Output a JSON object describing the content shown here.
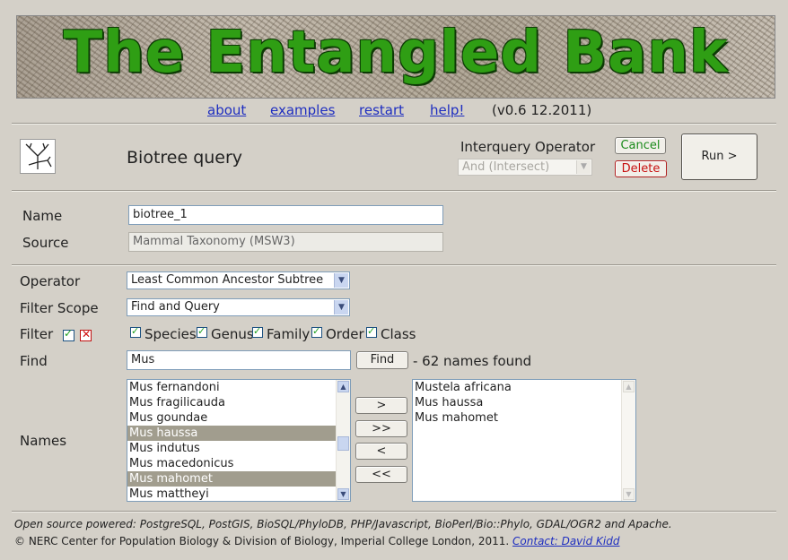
{
  "banner": {
    "title": "The Entangled Bank"
  },
  "nav": {
    "about": "about",
    "examples": "examples",
    "restart": "restart",
    "help": "help!",
    "version": "(v0.6 12.2011)"
  },
  "query": {
    "title": "Biotree query",
    "interquery_label": "Interquery Operator",
    "interquery_value": "And (Intersect)",
    "cancel_label": "Cancel",
    "delete_label": "Delete",
    "run_label": "Run >"
  },
  "form": {
    "name_label": "Name",
    "name_value": "biotree_1",
    "source_label": "Source",
    "source_value": "Mammal Taxonomy (MSW3)",
    "operator_label": "Operator",
    "operator_value": "Least Common Ancestor Subtree",
    "scope_label": "Filter Scope",
    "scope_value": "Find and Query",
    "filter_label": "Filter",
    "filters": [
      "Species",
      "Genus",
      "Family",
      "Order",
      "Class"
    ],
    "find_label": "Find",
    "find_value": "Mus",
    "find_button": "Find",
    "find_result": "- 62 names found",
    "names_label": "Names"
  },
  "names_list": [
    {
      "name": "Mus fernandoni",
      "selected": false
    },
    {
      "name": "Mus fragilicauda",
      "selected": false
    },
    {
      "name": "Mus goundae",
      "selected": false
    },
    {
      "name": "Mus haussa",
      "selected": true
    },
    {
      "name": "Mus indutus",
      "selected": false
    },
    {
      "name": "Mus macedonicus",
      "selected": false
    },
    {
      "name": "Mus mahomet",
      "selected": true
    },
    {
      "name": "Mus mattheyi",
      "selected": false
    }
  ],
  "transfer_buttons": [
    ">",
    ">>",
    "<",
    "<<"
  ],
  "selected_list": [
    "Mustela africana",
    "Mus haussa",
    "Mus mahomet"
  ],
  "footer": {
    "line1": "Open source powered: PostgreSQL, PostGIS, BioSQL/PhyloDB, PHP/Javascript, BioPerl/Bio::Phylo, GDAL/OGR2 and Apache.",
    "line2": "© NERC Center for Population Biology & Division of Biology, Imperial College London, 2011.",
    "contact": "Contact: David Kidd"
  },
  "colors": {
    "background": "#d4d0c8",
    "link": "#1e2ec0",
    "banner_text": "#2f9e14",
    "selection": "#a19d8e"
  }
}
